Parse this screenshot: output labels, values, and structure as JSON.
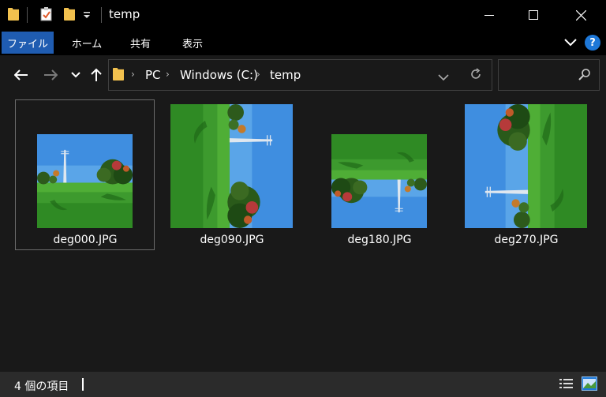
{
  "window": {
    "title": "temp"
  },
  "ribbon": {
    "tabs": [
      "ファイル",
      "ホーム",
      "共有",
      "表示"
    ],
    "help_label": "?"
  },
  "address": {
    "crumbs": [
      "PC",
      "Windows (C:)",
      "temp"
    ]
  },
  "files": [
    {
      "name": "deg000.JPG",
      "rotation": 0
    },
    {
      "name": "deg090.JPG",
      "rotation": 90
    },
    {
      "name": "deg180.JPG",
      "rotation": 180
    },
    {
      "name": "deg270.JPG",
      "rotation": 270
    }
  ],
  "status": {
    "item_count": "4 個の項目"
  },
  "colors": {
    "accent": "#1f5cb1",
    "help": "#1e78d8",
    "folder": "#f2c14e"
  }
}
